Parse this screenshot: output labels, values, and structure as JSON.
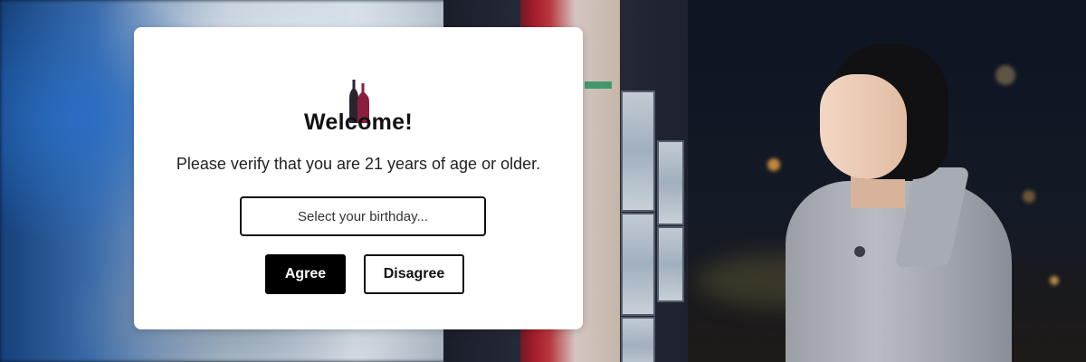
{
  "modal": {
    "title": "Welcome!",
    "message": "Please verify that you are 21 years of age or older.",
    "birthday_placeholder": "Select your birthday...",
    "birthday_value": "",
    "agree_label": "Agree",
    "disagree_label": "Disagree",
    "logo_icon": "wine-bottles-icon"
  },
  "colors": {
    "accent_wine": "#8b1e3f",
    "bottle_dark": "#2a2430",
    "button_primary": "#000000",
    "button_secondary_border": "#111111"
  }
}
